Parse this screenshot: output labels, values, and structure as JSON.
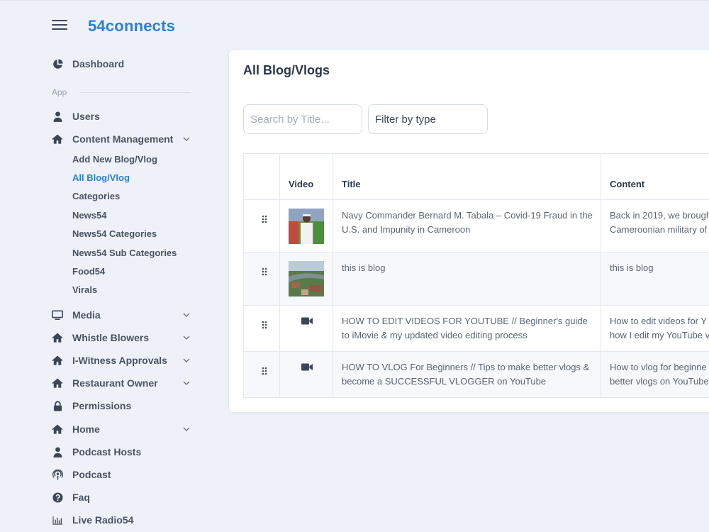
{
  "header": {
    "brand": "54connects"
  },
  "sidebar": {
    "dashboard": "Dashboard",
    "section_app": "App",
    "items": [
      {
        "label": "Users",
        "icon": "user-icon"
      },
      {
        "label": "Content Management",
        "icon": "home-icon",
        "expanded": true
      },
      {
        "label": "Media",
        "icon": "monitor-icon"
      },
      {
        "label": "Whistle Blowers",
        "icon": "home-icon"
      },
      {
        "label": "I-Witness Approvals",
        "icon": "home-icon"
      },
      {
        "label": "Restaurant Owner",
        "icon": "home-icon"
      },
      {
        "label": "Permissions",
        "icon": "lock-icon"
      },
      {
        "label": "Home",
        "icon": "home-icon"
      },
      {
        "label": "Podcast Hosts",
        "icon": "user-icon"
      },
      {
        "label": "Podcast",
        "icon": "podcast-icon"
      },
      {
        "label": "Faq",
        "icon": "question-circle-icon"
      },
      {
        "label": "Live Radio54",
        "icon": "bar-chart-icon"
      }
    ],
    "sub_items": [
      "Add New Blog/Vlog",
      "All Blog/Vlog",
      "Categories",
      "News54",
      "News54 Categories",
      "News54 Sub Categories",
      "Food54",
      "Virals"
    ],
    "active_sub_item": "All Blog/Vlog",
    "accent_color": "#2b7fd8"
  },
  "main": {
    "title": "All Blog/Vlogs",
    "search_placeholder": "Search by Title...",
    "filter_label": "Filter by type",
    "columns": [
      "Video",
      "Title",
      "Content"
    ],
    "rows": [
      {
        "media": "image",
        "title": "Navy Commander Bernard M. Tabala – Covid-19 Fraud in the U.S. and Impunity in Cameroon",
        "content_line1": "Back in 2019, we brough",
        "content_line2": "Cameroonian military of"
      },
      {
        "media": "image",
        "title": "this is blog",
        "content_line1": "this is blog",
        "content_line2": ""
      },
      {
        "media": "video",
        "title": "HOW TO EDIT VIDEOS FOR YOUTUBE // Beginner's guide to iMovie & my updated video editing process",
        "content_line1": "How to edit videos for Y",
        "content_line2": "how I edit my YouTube v"
      },
      {
        "media": "video",
        "title": "HOW TO VLOG For Beginners // Tips to make better vlogs & become a SUCCESSFUL VLOGGER on YouTube",
        "content_line1": "How to vlog for beginne",
        "content_line2": "better vlogs on YouTube"
      }
    ]
  }
}
